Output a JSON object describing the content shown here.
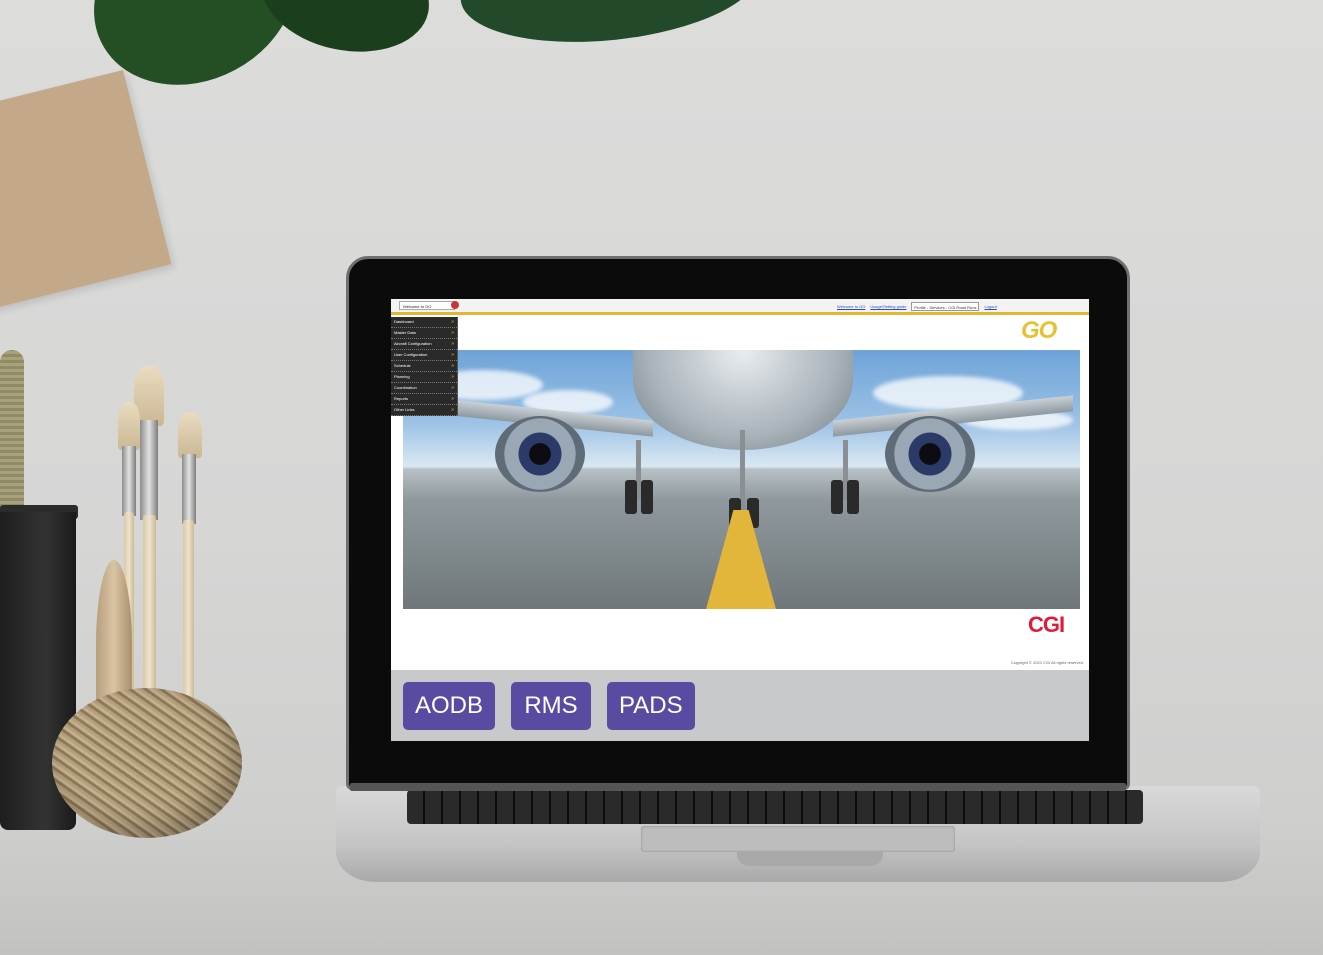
{
  "app": {
    "tab_label": "Welcome to GO",
    "user_links": {
      "welcome": "Welcome to GO",
      "guide": "Usage/Setting guide",
      "profile": "Profile - Services - CGI Road Runs",
      "logout": "Logout"
    },
    "brand_mark": "GO",
    "company_logo": "CGI",
    "copyright": "Copyright © 2020 CGI All rights reserved"
  },
  "menu": {
    "items": [
      {
        "label": "Dashboard"
      },
      {
        "label": "Master Data"
      },
      {
        "label": "Aircraft Configuration"
      },
      {
        "label": "User Configuration"
      },
      {
        "label": "Schedule"
      },
      {
        "label": "Planning"
      },
      {
        "label": "Coordination"
      },
      {
        "label": "Reports"
      },
      {
        "label": "Other Links"
      }
    ]
  },
  "products": {
    "buttons": [
      {
        "label": "AODB"
      },
      {
        "label": "RMS"
      },
      {
        "label": "PADS"
      }
    ]
  },
  "colors": {
    "button_bg": "#5a4ba2",
    "accent_bar": "#e6b62f",
    "cgi_red": "#e31937"
  }
}
